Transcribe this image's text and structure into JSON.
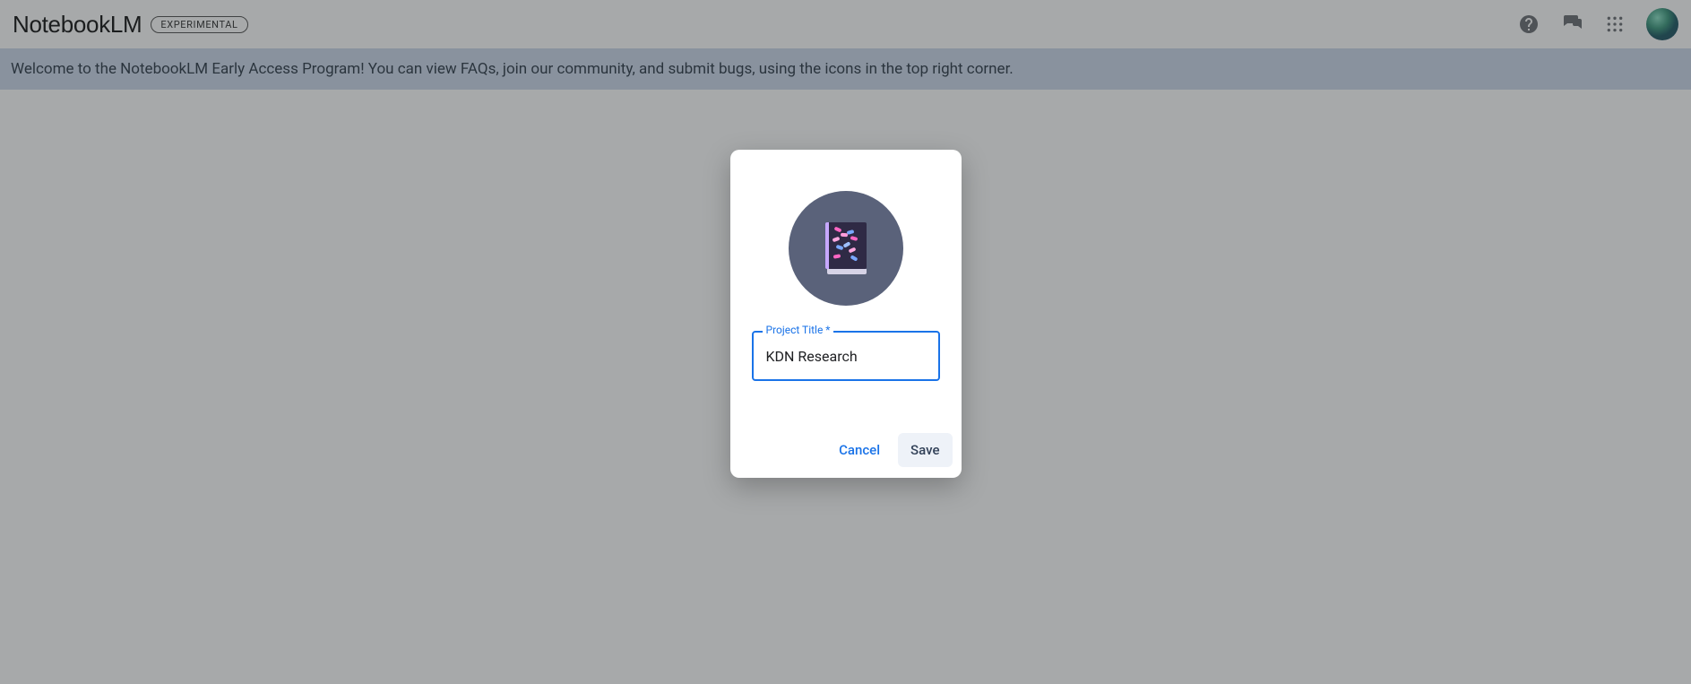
{
  "header": {
    "brand": "NotebookLM",
    "badge": "EXPERIMENTAL"
  },
  "banner": {
    "text": "Welcome to the NotebookLM Early Access Program! You can view FAQs, join our community, and submit bugs, using the icons in the top right corner."
  },
  "dialog": {
    "field_label": "Project Title *",
    "field_value": "KDN Research",
    "cancel_label": "Cancel",
    "save_label": "Save"
  },
  "icons": {
    "help": "help-icon",
    "feedback": "feedback-icon",
    "apps": "apps-grid-icon",
    "avatar": "user-avatar"
  },
  "colors": {
    "accent": "#1a73e8",
    "banner_bg": "#c9d5e9",
    "dialog_circle": "#5a627a"
  }
}
